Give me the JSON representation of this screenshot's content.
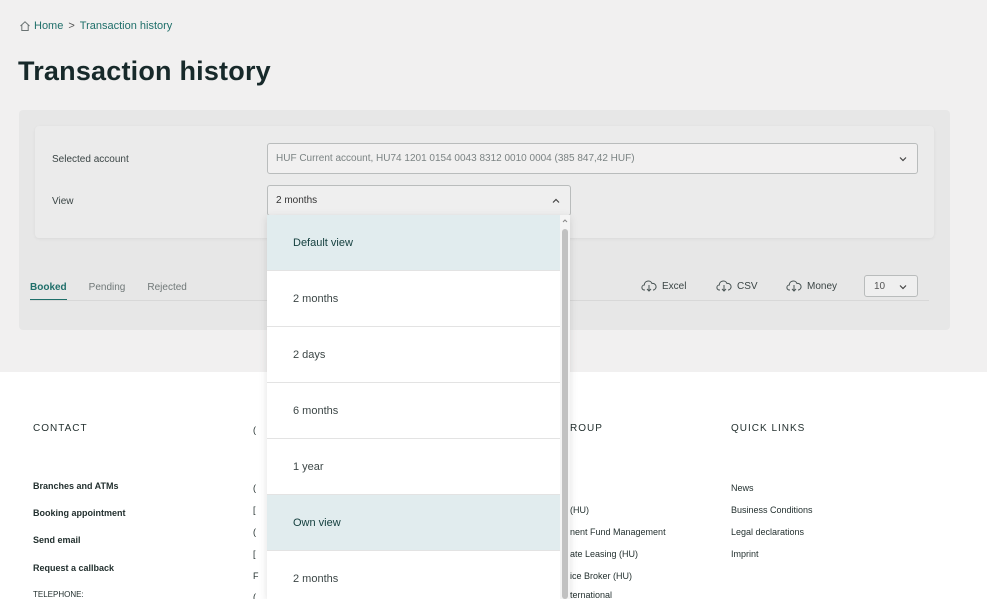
{
  "breadcrumb": {
    "home": "Home",
    "separator": ">",
    "current": "Transaction history"
  },
  "page_title": "Transaction history",
  "form": {
    "account_label": "Selected account",
    "account_value": "HUF Current account, HU74 1201 0154 0043 8312 0010 0004 (385 847,42 HUF)",
    "view_label": "View",
    "view_value": "2 months"
  },
  "tabs": [
    "Booked",
    "Pending",
    "Rejected"
  ],
  "active_tab": "Booked",
  "exports": [
    "Excel",
    "CSV",
    "Money"
  ],
  "page_size": "10",
  "dropdown": {
    "items": [
      "Default view",
      "2 months",
      "2 days",
      "6 months",
      "1 year",
      "Own view",
      "2 months"
    ],
    "highlighted": [
      "Default view",
      "Own view"
    ]
  },
  "footer": {
    "contact": {
      "heading": "CONTACT",
      "links": [
        "Branches and ATMs",
        "Booking appointment",
        "Send email",
        "Request a callback",
        "TELEPHONE:"
      ]
    },
    "group_partial": {
      "heading_partial": "ROUP",
      "links_partial": [
        "(HU)",
        "nent Fund Management",
        "ate Leasing (HU)",
        "ice Broker (HU)",
        "ternational"
      ]
    },
    "quick_links": {
      "heading": "QUICK LINKS",
      "links": [
        "News",
        "Business Conditions",
        "Legal declarations",
        "Imprint"
      ]
    },
    "hidden_col_fragments": [
      "(",
      "(",
      "(",
      "[",
      "(",
      "[",
      "F",
      "("
    ]
  },
  "colors": {
    "accent": "#1f6f6a",
    "highlight": "#e1ecee",
    "background": "#f1f0f0"
  }
}
